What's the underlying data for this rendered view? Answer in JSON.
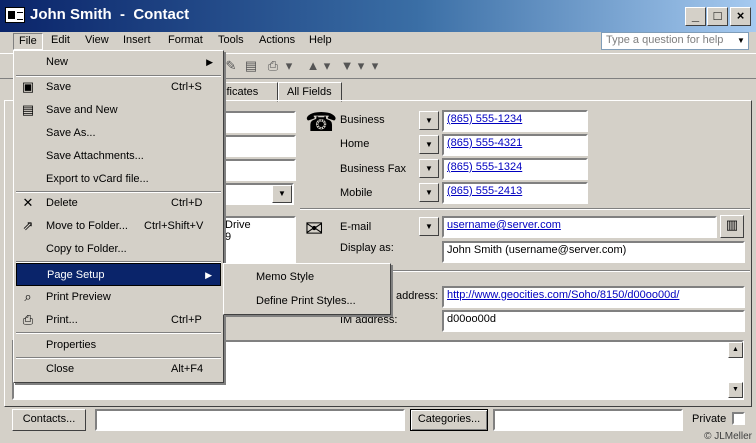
{
  "window": {
    "title": "John Smith  -  Contact"
  },
  "menubar": {
    "items": [
      "File",
      "Edit",
      "View",
      "Insert",
      "Format",
      "Tools",
      "Actions",
      "Help"
    ],
    "help_placeholder": "Type a question for help"
  },
  "tabs": {
    "partial": "tificates",
    "all_fields": "All Fields"
  },
  "left_fields": {
    "address_partial_1": "Drive",
    "address_partial_2": "9"
  },
  "phones": {
    "business": {
      "label": "Business",
      "value": "(865) 555-1234"
    },
    "home": {
      "label": "Home",
      "value": "(865) 555-4321"
    },
    "business_fax": {
      "label": "Business Fax",
      "value": "(865) 555-1324"
    },
    "mobile": {
      "label": "Mobile",
      "value": "(865) 555-2413"
    }
  },
  "email": {
    "label": "E-mail",
    "value": "username@server.com",
    "display_as_label": "Display as:",
    "display_as_value": "John Smith (username@server.com)"
  },
  "web": {
    "label": "address:",
    "value": "http://www.geocities.com/Soho/8150/d00oo00d/"
  },
  "im": {
    "label": "IM address:",
    "value": "d00oo00d"
  },
  "bottom": {
    "contacts_button": "Contacts...",
    "categories_button": "Categories...",
    "private_label": "Private"
  },
  "file_menu": {
    "new": "New",
    "save": "Save",
    "save_sc": "Ctrl+S",
    "save_and_new": "Save and New",
    "save_as": "Save As...",
    "save_attachments": "Save Attachments...",
    "export_vcard": "Export to vCard file...",
    "delete": "Delete",
    "delete_sc": "Ctrl+D",
    "move_to_folder": "Move to Folder...",
    "move_sc": "Ctrl+Shift+V",
    "copy_to_folder": "Copy to Folder...",
    "page_setup": "Page Setup",
    "print_preview": "Print Preview",
    "print": "Print...",
    "print_sc": "Ctrl+P",
    "properties": "Properties",
    "close": "Close",
    "close_sc": "Alt+F4"
  },
  "page_setup_submenu": {
    "memo_style": "Memo Style",
    "define_print_styles": "Define Print Styles..."
  },
  "credit": "© JLMeller",
  "colors": {
    "titlebar": "#0a246a",
    "highlight": "#0a246a",
    "link": "#0000c0"
  }
}
